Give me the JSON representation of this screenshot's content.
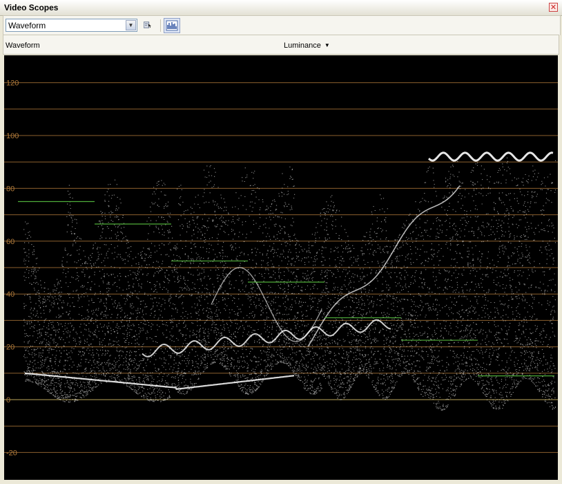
{
  "window": {
    "title": "Video Scopes"
  },
  "toolbar": {
    "scope_selected": "Waveform",
    "select_tool_icon": "pointer-select-icon",
    "scope_view_icon": "waveform-bars-icon"
  },
  "header": {
    "scope_label": "Waveform",
    "mode_label": "Luminance"
  },
  "colors": {
    "graticule": "#b07a3a",
    "zero_line": "#c8b060",
    "color_bar_guides": "#4fae3a",
    "trace": "#ffffff",
    "background": "#000000"
  },
  "chart_data": {
    "type": "scatter",
    "title": "",
    "xlabel": "",
    "ylabel": "",
    "ylim": [
      -25,
      130
    ],
    "y_ticks": [
      "120",
      "100",
      "80",
      "60",
      "40",
      "20",
      "0",
      "-20"
    ],
    "gridlines_ire": [
      120,
      110,
      100,
      90,
      80,
      70,
      60,
      50,
      40,
      30,
      20,
      10,
      0,
      -10,
      -20
    ],
    "grid": true,
    "color_bar_levels_ire": [
      75,
      66.5,
      52.5,
      44.5,
      31,
      22.5,
      9
    ]
  }
}
